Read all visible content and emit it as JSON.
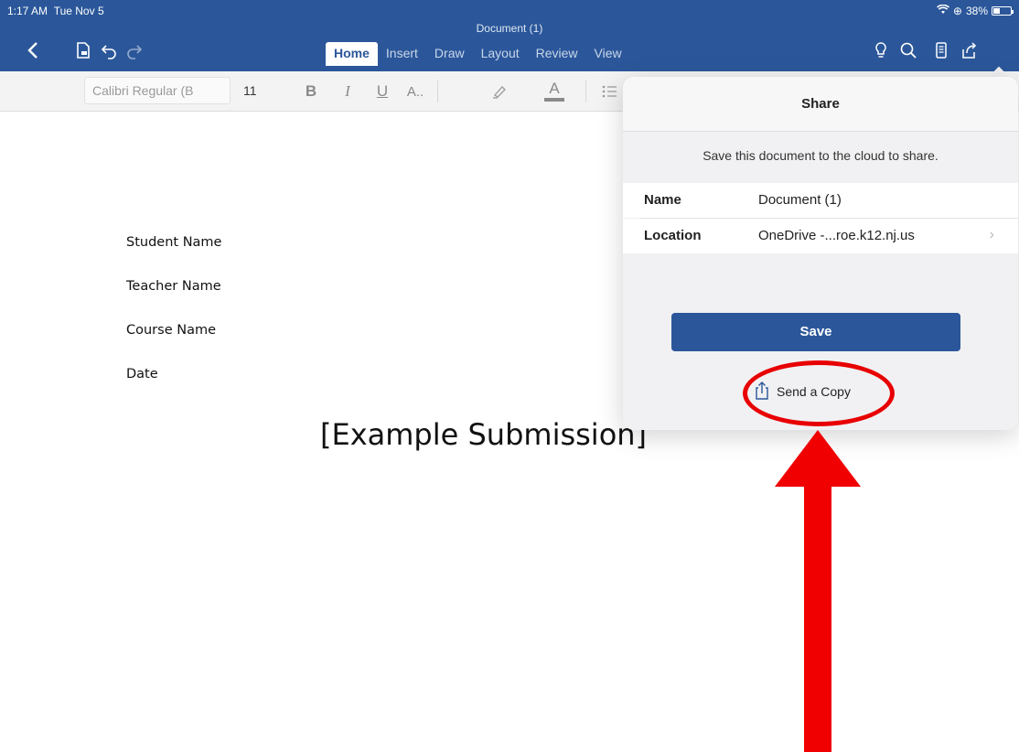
{
  "status_bar": {
    "time": "1:17 AM",
    "date": "Tue Nov 5",
    "battery": "38%",
    "battery_level": 0.38
  },
  "document_title": "Document (1)",
  "toolbar": {
    "tabs": [
      {
        "label": "Home",
        "active": true
      },
      {
        "label": "Insert",
        "active": false
      },
      {
        "label": "Draw",
        "active": false
      },
      {
        "label": "Layout",
        "active": false
      },
      {
        "label": "Review",
        "active": false
      },
      {
        "label": "View",
        "active": false
      }
    ]
  },
  "ribbon": {
    "font_name": "Calibri Regular (B",
    "font_size": "11",
    "bold": "B",
    "italic": "I",
    "underline": "U",
    "text_effects": "A..",
    "font_color": "A"
  },
  "document": {
    "lines": [
      "Student Name",
      "Teacher Name",
      "Course Name",
      "Date"
    ],
    "watermark": "[Example Submission]"
  },
  "share_popover": {
    "title": "Share",
    "description": "Save this document to the cloud to share.",
    "name_label": "Name",
    "name_value": "Document (1)",
    "location_label": "Location",
    "location_value": "OneDrive -...roe.k12.nj.us",
    "save_label": "Save",
    "send_copy_label": "Send a Copy"
  },
  "colors": {
    "brand_blue": "#2b579a",
    "annotation_red": "#f00000"
  }
}
